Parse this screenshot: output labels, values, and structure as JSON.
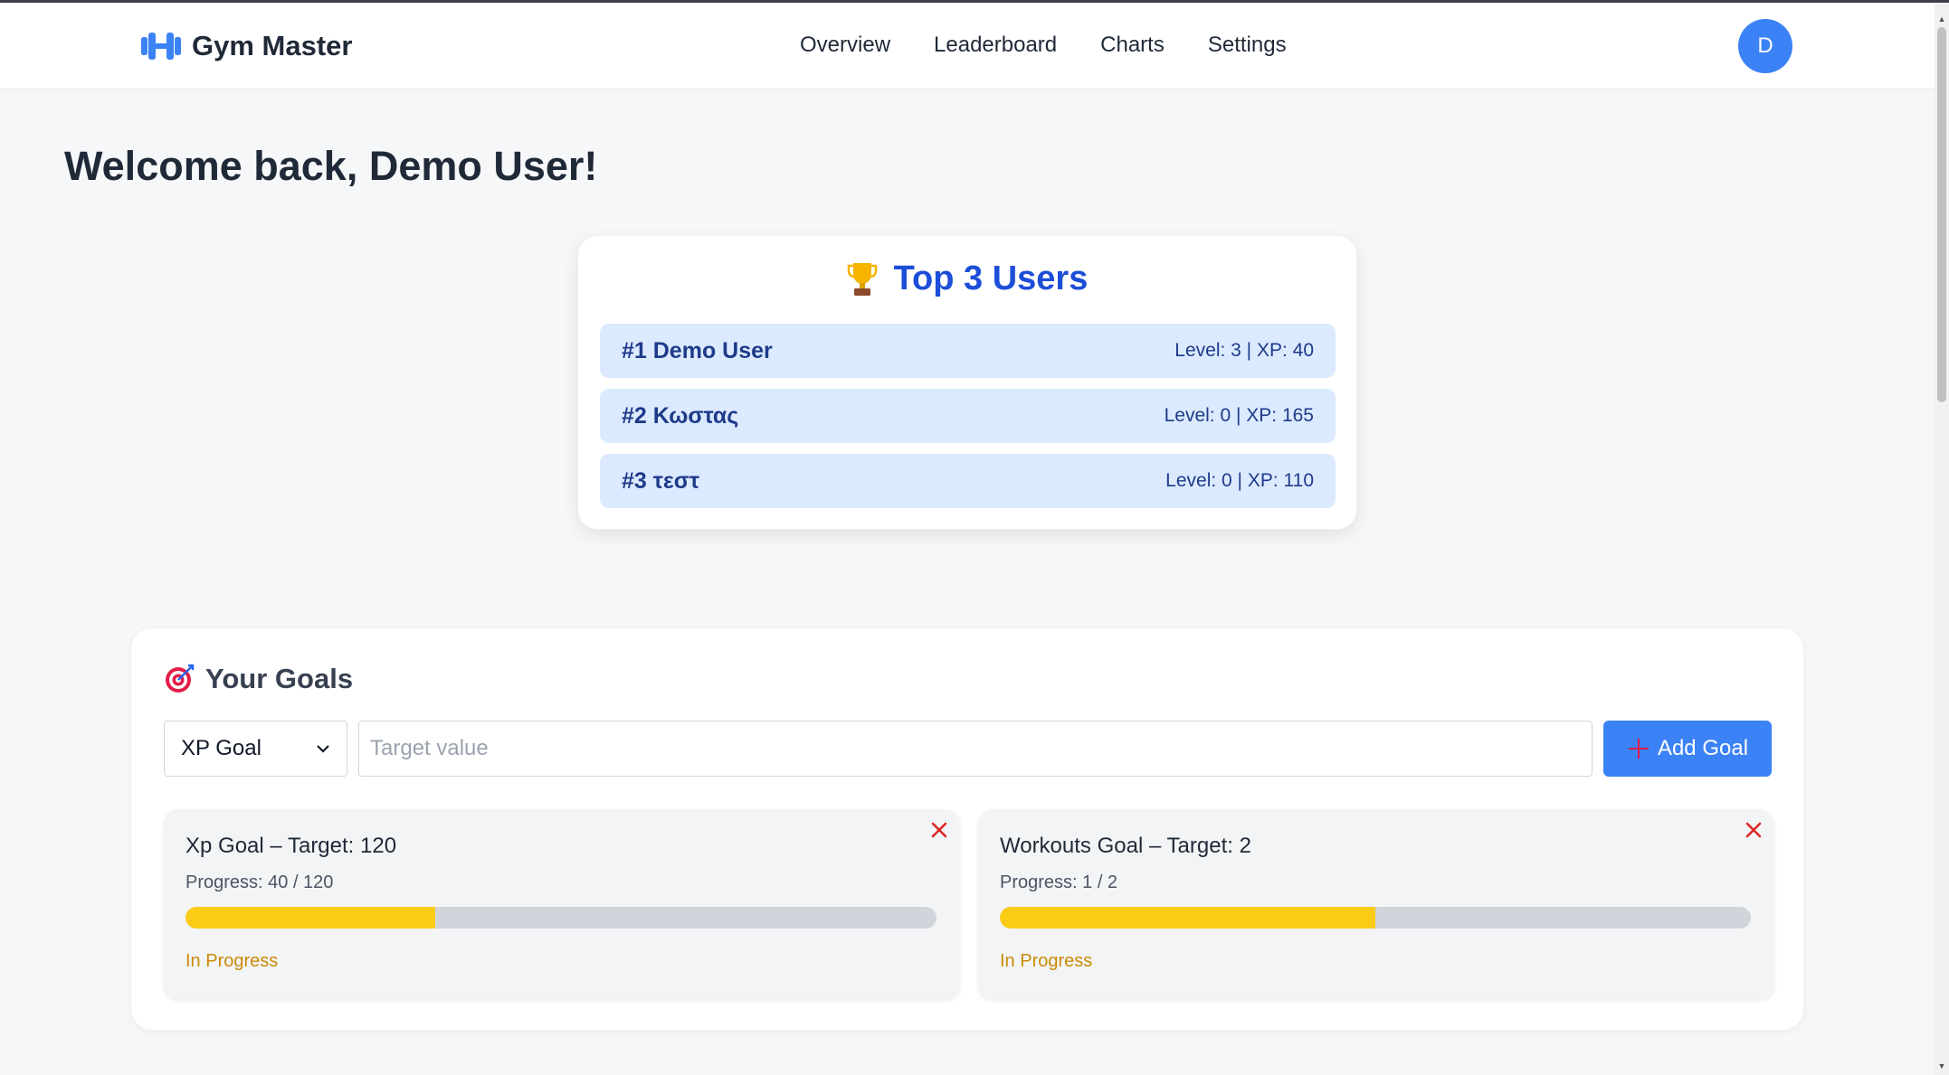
{
  "navbar": {
    "brand": "Gym Master",
    "brand_icon": "dumbbell-icon",
    "links": [
      "Overview",
      "Leaderboard",
      "Charts",
      "Settings"
    ],
    "avatar_initial": "D"
  },
  "welcome": "Welcome back, Demo User!",
  "top_users": {
    "icon": "trophy-icon",
    "title": "Top 3 Users",
    "users": [
      {
        "rank": "#1 Demo User",
        "stats": "Level: 3 | XP: 40"
      },
      {
        "rank": "#2 Κωστας",
        "stats": "Level: 0 | XP: 165"
      },
      {
        "rank": "#3 τεστ",
        "stats": "Level: 0 | XP: 110"
      }
    ]
  },
  "goals": {
    "icon": "target-icon",
    "title": "Your Goals",
    "form": {
      "selected_type": "XP Goal",
      "target_placeholder": "Target value",
      "add_label": "Add Goal"
    },
    "items": [
      {
        "name": "Xp Goal – Target: 120",
        "progress_text": "Progress: 40 / 120",
        "progress": 0.333,
        "status": "In Progress"
      },
      {
        "name": "Workouts Goal – Target: 2",
        "progress_text": "Progress: 1 / 2",
        "progress": 0.5,
        "status": "In Progress"
      }
    ]
  },
  "colors": {
    "accent": "#3b82f6",
    "title_blue": "#1d4ed8",
    "row_bg": "#dbeafe",
    "progress_fill": "#facc15",
    "status": "#ca8a04",
    "close": "#dc2626"
  }
}
